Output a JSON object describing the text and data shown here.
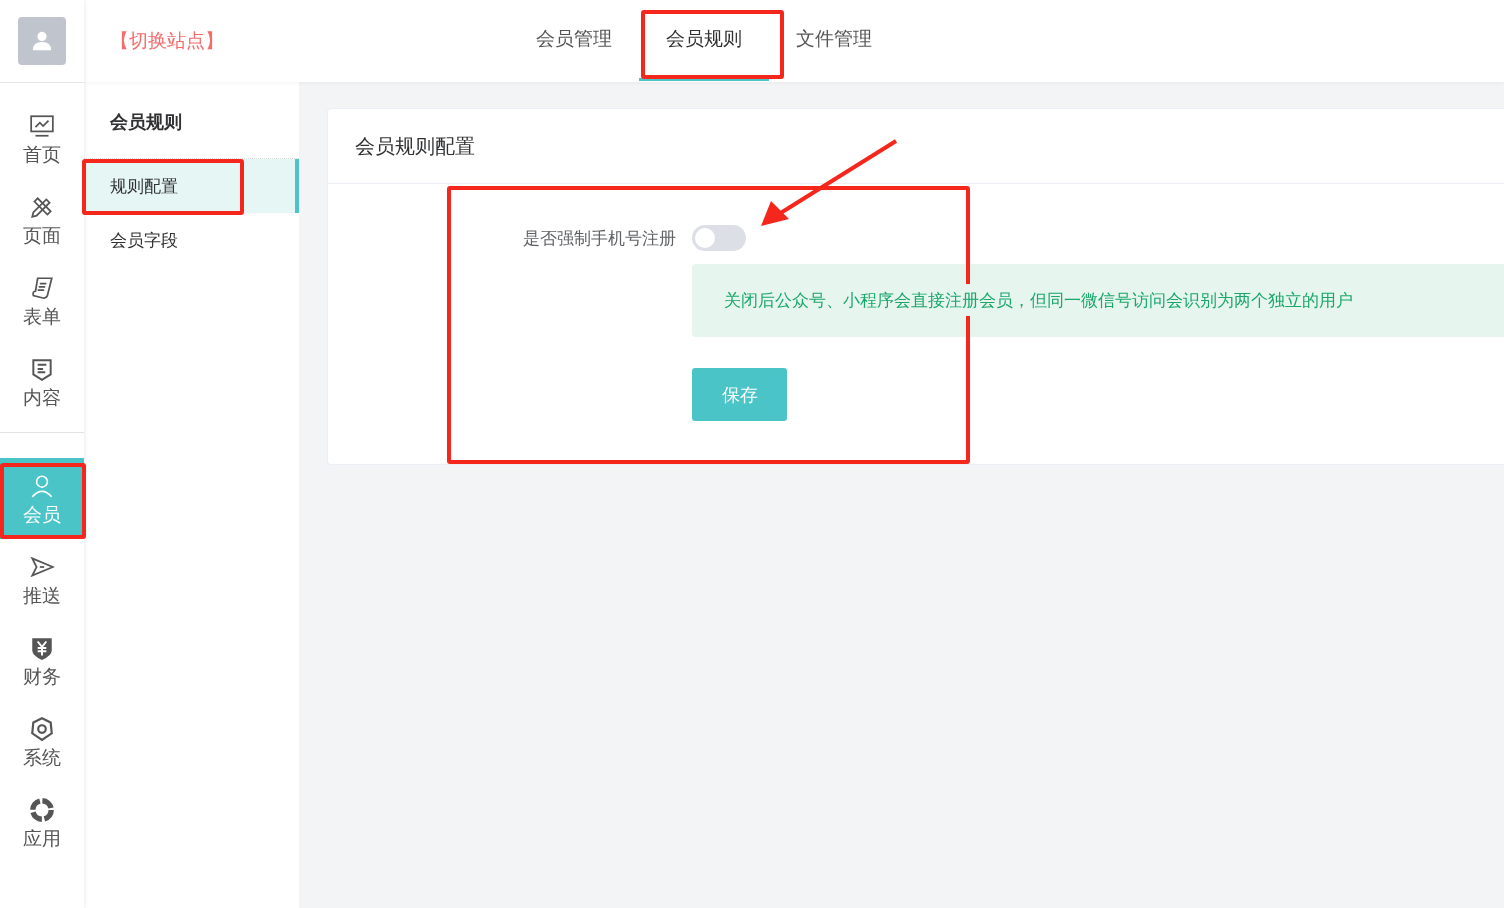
{
  "site_switch": "【切换站点】",
  "top_tabs": [
    {
      "label": "会员管理",
      "selected": false
    },
    {
      "label": "会员规则",
      "selected": true
    },
    {
      "label": "文件管理",
      "selected": false
    }
  ],
  "rail_groups": [
    {
      "items": [
        {
          "label": "首页",
          "selected": false
        },
        {
          "label": "页面",
          "selected": false
        },
        {
          "label": "表单",
          "selected": false
        },
        {
          "label": "内容",
          "selected": false
        }
      ]
    },
    {
      "items": [
        {
          "label": "会员",
          "selected": true
        },
        {
          "label": "推送",
          "selected": false
        },
        {
          "label": "财务",
          "selected": false
        },
        {
          "label": "系统",
          "selected": false
        },
        {
          "label": "应用",
          "selected": false
        }
      ]
    }
  ],
  "submenu": {
    "title": "会员规则",
    "items": [
      {
        "label": "规则配置",
        "selected": true
      },
      {
        "label": "会员字段",
        "selected": false
      }
    ]
  },
  "card": {
    "title": "会员规则配置",
    "fields": [
      {
        "kind": "switch",
        "label": "是否强制手机号注册",
        "on": false
      }
    ],
    "notice": "关闭后公众号、小程序会直接注册会员，但同一微信号访问会识别为两个独立的用户",
    "save_button": "保存"
  }
}
